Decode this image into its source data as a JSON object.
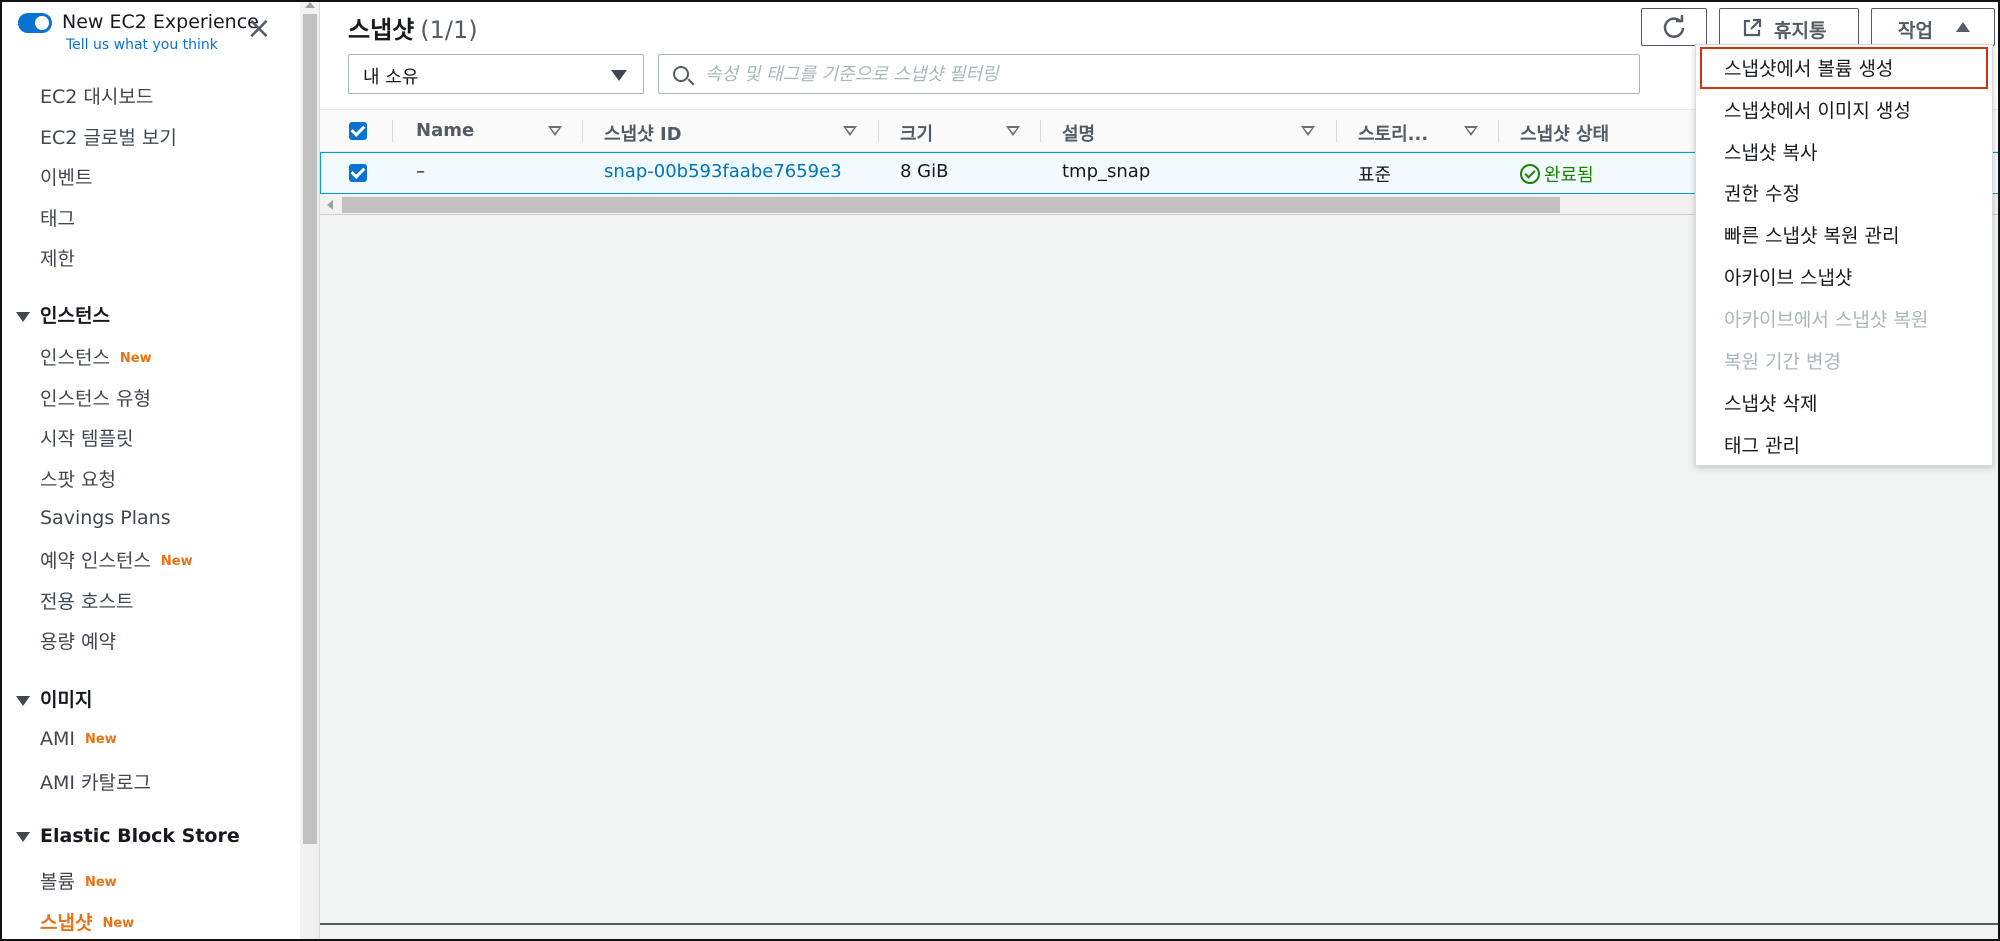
{
  "sidebar": {
    "experience_title": "New EC2 Experience",
    "experience_link": "Tell us what you think",
    "items_top": [
      "EC2 대시보드",
      "EC2 글로벌 보기",
      "이벤트",
      "태그",
      "제한"
    ],
    "section_instances": "인스턴스",
    "instances_items": [
      "인스턴스",
      "인스턴스 유형",
      "시작 템플릿",
      "스팟 요청",
      "Savings Plans",
      "예약 인스턴스",
      "전용 호스트",
      "용량 예약"
    ],
    "section_images": "이미지",
    "images_items": [
      "AMI",
      "AMI 카탈로그"
    ],
    "section_ebs": "Elastic Block Store",
    "ebs_items": [
      "볼륨",
      "스냅샷"
    ],
    "new_badge": "New"
  },
  "header": {
    "title": "스냅샷",
    "count": "(1/1)",
    "trash_label": "휴지통",
    "actions_label": "작업"
  },
  "filter": {
    "owner_value": "내 소유",
    "search_placeholder": "속성 및 태그를 기준으로 스냅샷 필터링"
  },
  "table": {
    "columns": [
      "Name",
      "스냅샷 ID",
      "크기",
      "설명",
      "스토리...",
      "스냅샷 상태"
    ],
    "row": {
      "name": "–",
      "snapshot_id": "snap-00b593faabe7659e3",
      "size": "8 GiB",
      "description": "tmp_snap",
      "storage": "표준",
      "status": "완료됨"
    }
  },
  "menu": {
    "items": [
      "스냅샷에서 볼륨 생성",
      "스냅샷에서 이미지 생성",
      "스냅샷 복사",
      "권한 수정",
      "빠른 스냅샷 복원 관리",
      "아카이브 스냅샷",
      "아카이브에서 스냅샷 복원",
      "복원 기간 변경",
      "스냅샷 삭제",
      "태그 관리"
    ]
  },
  "colors": {
    "accent": "#0972d3",
    "active_nav": "#ec7211",
    "success": "#1d8102",
    "highlight_border": "#d13212"
  }
}
